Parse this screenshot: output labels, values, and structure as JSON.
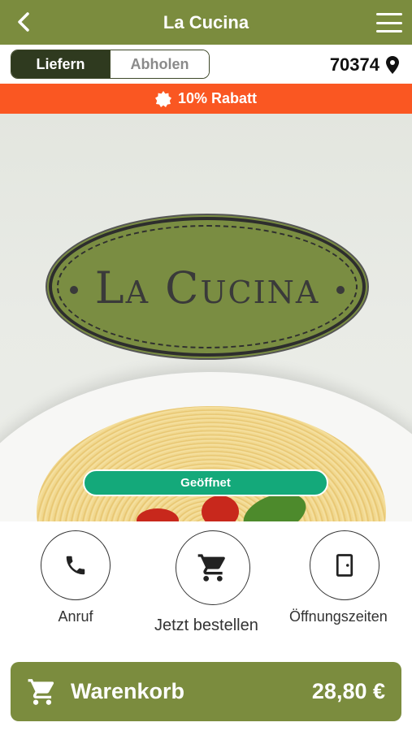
{
  "header": {
    "title": "La Cucina",
    "back_icon": "chevron-left-icon",
    "menu_icon": "hamburger-menu-icon"
  },
  "mode": {
    "deliver_label": "Liefern",
    "pickup_label": "Abholen",
    "selected": "Liefern"
  },
  "location": {
    "zip": "70374",
    "icon": "map-pin-icon"
  },
  "promo": {
    "text": "10% Rabatt",
    "icon": "badge-icon"
  },
  "hero": {
    "logo_text": "La Cucina",
    "status": "Geöffnet"
  },
  "actions": {
    "call": {
      "label": "Anruf",
      "icon": "phone-icon"
    },
    "order": {
      "label": "Jetzt bestellen",
      "icon": "cart-icon"
    },
    "hours": {
      "label": "Öffnungszeiten",
      "icon": "door-icon"
    }
  },
  "cart": {
    "label": "Warenkorb",
    "total": "28,80 €",
    "icon": "cart-icon"
  },
  "colors": {
    "brand": "#7b8c3e",
    "promo": "#fa5722",
    "open": "#14a97a",
    "toggle_active": "#2f3a1f"
  }
}
